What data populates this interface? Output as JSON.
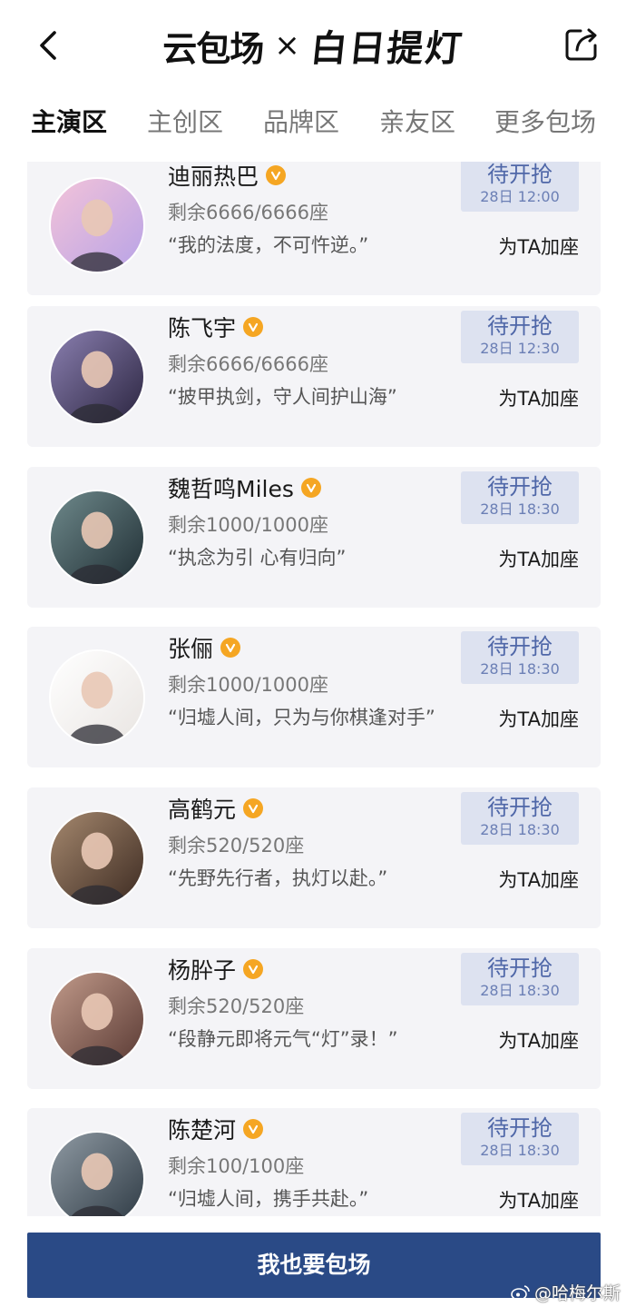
{
  "header": {
    "logo_left": "云包场",
    "logo_x": "×",
    "logo_right": "白日提灯"
  },
  "tabs": [
    {
      "label": "主演区",
      "active": true
    },
    {
      "label": "主创区",
      "active": false
    },
    {
      "label": "品牌区",
      "active": false
    },
    {
      "label": "亲友区",
      "active": false
    },
    {
      "label": "更多包场",
      "active": false
    }
  ],
  "cards": [
    {
      "name": "迪丽热巴",
      "seats": "剩余6666/6666座",
      "quote": "“我的法度，不可忤逆。”",
      "status": "待开抢",
      "time": "28日 12:00",
      "cheer": "为TA加座",
      "avatar_colors": [
        "#f3c3d9",
        "#b8a3e6"
      ]
    },
    {
      "name": "陈飞宇",
      "seats": "剩余6666/6666座",
      "quote": "“披甲执剑，守人间护山海”",
      "status": "待开抢",
      "time": "28日 12:30",
      "cheer": "为TA加座",
      "avatar_colors": [
        "#8a7fb0",
        "#2b2540"
      ]
    },
    {
      "name": "魏哲鸣Miles",
      "seats": "剩余1000/1000座",
      "quote": "“执念为引 心有归向”",
      "status": "待开抢",
      "time": "28日 18:30",
      "cheer": "为TA加座",
      "avatar_colors": [
        "#6f8a8c",
        "#1f2d33"
      ]
    },
    {
      "name": "张俪",
      "seats": "剩余1000/1000座",
      "quote": "“归墟人间，只为与你棋逢对手”",
      "status": "待开抢",
      "time": "28日 18:30",
      "cheer": "为TA加座",
      "avatar_colors": [
        "#ffffff",
        "#e9e5e2"
      ]
    },
    {
      "name": "高鹤元",
      "seats": "剩余520/520座",
      "quote": "“先野先行者，执灯以赴。”",
      "status": "待开抢",
      "time": "28日 18:30",
      "cheer": "为TA加座",
      "avatar_colors": [
        "#a5886e",
        "#3d2b22"
      ]
    },
    {
      "name": "杨肸子",
      "seats": "剩余520/520座",
      "quote": "“段静元即将元气“灯”录！”",
      "status": "待开抢",
      "time": "28日 18:30",
      "cheer": "为TA加座",
      "avatar_colors": [
        "#c19a8a",
        "#5a3a34"
      ]
    },
    {
      "name": "陈楚河",
      "seats": "剩余100/100座",
      "quote": "“归墟人间，携手共赴。”",
      "status": "待开抢",
      "time": "28日 18:30",
      "cheer": "为TA加座",
      "avatar_colors": [
        "#8f9aa3",
        "#2e3a44"
      ]
    }
  ],
  "cta": {
    "label": "我也要包场"
  },
  "watermark": {
    "text": "@哈梅尔斯"
  },
  "colors": {
    "accent": "#2a4a86",
    "status_bg": "#dde2f0",
    "status_text": "#4f67a8",
    "verify": "#f5a623",
    "card_bg": "#f4f4f7"
  }
}
